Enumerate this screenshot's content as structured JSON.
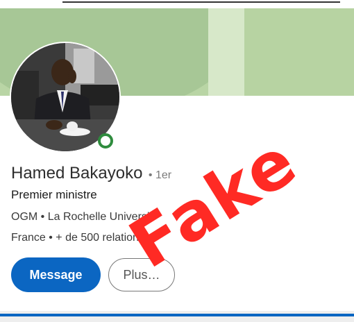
{
  "profile": {
    "name": "Hamed Bakayoko",
    "degree": "• 1er",
    "headline": "Premier ministre",
    "organization": "OGM  • La Rochelle Universit",
    "location": "France • + de 500 relations"
  },
  "actions": {
    "message_label": "Message",
    "more_label": "Plus…"
  },
  "overlay": {
    "stamp_text": "Fake"
  },
  "colors": {
    "primary": "#0b66c2",
    "online": "#2f8c3e",
    "banner": "#b9d5a5",
    "stamp": "#ff2a24"
  }
}
